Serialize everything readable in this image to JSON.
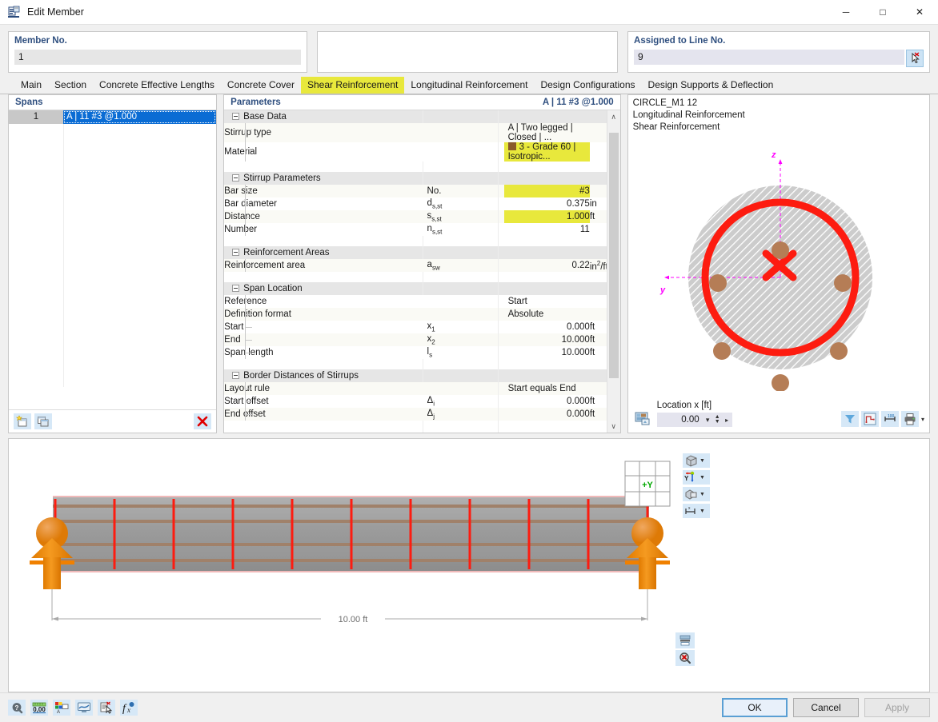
{
  "window": {
    "title": "Edit Member",
    "icon": "edit-member-icon",
    "minimize": "─",
    "maximize": "□",
    "close": "✕"
  },
  "header": {
    "member_no_label": "Member No.",
    "member_no_value": "1",
    "middle_label": "",
    "middle_value": "",
    "assigned_label": "Assigned to Line No.",
    "assigned_value": "9",
    "pick_icon": "pick-line-icon"
  },
  "tabs": {
    "active": "Shear Reinforcement",
    "items": [
      "Main",
      "Section",
      "Concrete Effective Lengths",
      "Concrete Cover",
      "Shear Reinforcement",
      "Longitudinal Reinforcement",
      "Design Configurations",
      "Design Supports & Deflection"
    ]
  },
  "spans": {
    "header": "Spans",
    "rows": [
      {
        "no": "1",
        "value": "A | 11 #3 @1.000"
      }
    ],
    "footer": {
      "new_icon": "new-span-icon",
      "copy_icon": "copy-span-icon",
      "delete_icon": "delete-icon"
    }
  },
  "parameters": {
    "header": "Parameters",
    "header_right": "A | 11 #3 @1.000",
    "groups": [
      {
        "name": "Base Data",
        "rows": [
          {
            "name": "Stirrup type",
            "symbol": "",
            "value": "A | Two legged | Closed | ...",
            "unit": "",
            "align": "left",
            "highlight": false,
            "swatch": null
          },
          {
            "name": "Material",
            "symbol": "",
            "value": "3 - Grade 60 | Isotropic...",
            "unit": "",
            "align": "left",
            "highlight": true,
            "swatch": "#8a5a2b"
          }
        ]
      },
      {
        "name": "Stirrup Parameters",
        "rows": [
          {
            "name": "Bar size",
            "symbol": "No.",
            "value": "#3",
            "unit": "",
            "align": "right",
            "highlight": true,
            "swatch": null
          },
          {
            "name": "Bar diameter",
            "symbol": "ds,st",
            "value": "0.375",
            "unit": "in",
            "align": "right",
            "highlight": false,
            "swatch": null
          },
          {
            "name": "Distance",
            "symbol": "ss,st",
            "value": "1.000",
            "unit": "ft",
            "align": "right",
            "highlight": true,
            "swatch": null
          },
          {
            "name": "Number",
            "symbol": "ns,st",
            "value": "11",
            "unit": "",
            "align": "right",
            "highlight": false,
            "swatch": null
          }
        ]
      },
      {
        "name": "Reinforcement Areas",
        "rows": [
          {
            "name": "Reinforcement area",
            "symbol": "asw",
            "value": "0.22",
            "unit": "in²/ft",
            "align": "right",
            "highlight": false,
            "swatch": null
          }
        ]
      },
      {
        "name": "Span Location",
        "rows": [
          {
            "name": "Reference",
            "symbol": "",
            "value": "Start",
            "unit": "",
            "align": "left",
            "highlight": false,
            "swatch": null
          },
          {
            "name": "Definition format",
            "symbol": "",
            "value": "Absolute",
            "unit": "",
            "align": "left",
            "highlight": false,
            "swatch": null
          },
          {
            "name": "Start",
            "symbol": "x1",
            "value": "0.000",
            "unit": "ft",
            "align": "right",
            "highlight": false,
            "swatch": null
          },
          {
            "name": "End",
            "symbol": "x2",
            "value": "10.000",
            "unit": "ft",
            "align": "right",
            "highlight": false,
            "swatch": null
          },
          {
            "name": "Span length",
            "symbol": "ls",
            "value": "10.000",
            "unit": "ft",
            "align": "right",
            "highlight": false,
            "swatch": null
          }
        ]
      },
      {
        "name": "Border Distances of Stirrups",
        "rows": [
          {
            "name": "Layout rule",
            "symbol": "",
            "value": "Start equals End",
            "unit": "",
            "align": "left",
            "highlight": false,
            "swatch": null
          },
          {
            "name": "Start offset",
            "symbol": "Δi",
            "value": "0.000",
            "unit": "ft",
            "align": "right",
            "highlight": false,
            "swatch": null
          },
          {
            "name": "End offset",
            "symbol": "Δj",
            "value": "0.000",
            "unit": "ft",
            "align": "right",
            "highlight": false,
            "swatch": null
          }
        ]
      }
    ],
    "scroll_up": "∧",
    "scroll_down": "∨"
  },
  "section_view": {
    "title_lines": [
      "CIRCLE_M1 12",
      "Longitudinal Reinforcement",
      "Shear Reinforcement"
    ],
    "axis_z": "z",
    "axis_y": "y",
    "stirrup_color": "#fd1c10",
    "rebar_color": "#b57d56",
    "concrete_color": "#cccccc",
    "axis_color": "#ff00ff",
    "footer": {
      "location_label": "Location x [ft]",
      "location_value": "0.00",
      "render_icon": "render-mode-icon",
      "filter_icon": "filter-icon",
      "dimensions_icon": "dimensions-icon",
      "scale-icon": "scale-icon",
      "print_icon": "print-icon",
      "dropdown_caret": "▾"
    }
  },
  "model_view": {
    "dimension_label": "10.00 ft",
    "axis_badge": "+Y",
    "beam_color": "#9a9a9a",
    "rebar_color": "#a0816a",
    "stirrup_color": "#fd1c10",
    "support_color": "#f08000",
    "stirrup_count": 11,
    "toolbar": [
      {
        "icon": "render-cube-icon",
        "caret": "▾"
      },
      {
        "icon": "axis-system-icon",
        "caret": "▾"
      },
      {
        "icon": "section-view-icon",
        "caret": "▾"
      },
      {
        "icon": "dimension-icon",
        "caret": "▾"
      }
    ],
    "corner_tools": [
      {
        "icon": "table-view-icon"
      },
      {
        "icon": "zoom-reset-icon"
      }
    ]
  },
  "bottom_bar": {
    "tools": [
      "help-icon",
      "units-icon",
      "display-properties-icon",
      "visual-objects-icon",
      "comment-icon",
      "formula-icon"
    ],
    "ok_label": "OK",
    "cancel_label": "Cancel",
    "apply_label": "Apply"
  }
}
